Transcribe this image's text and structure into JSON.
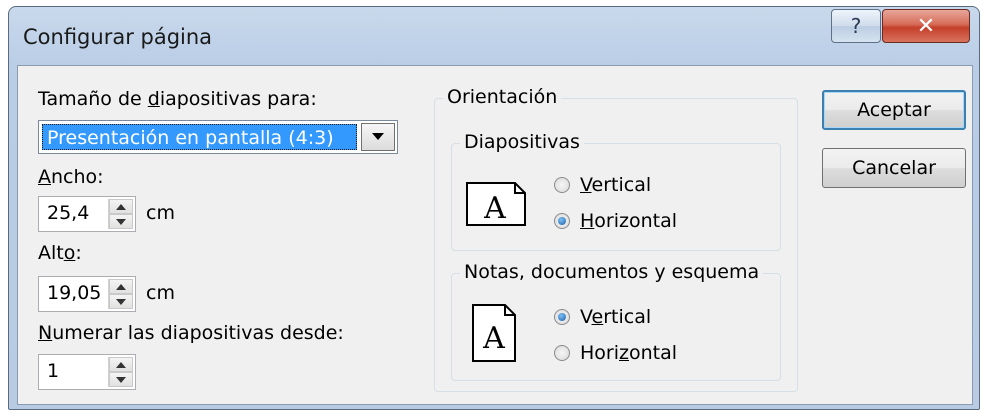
{
  "window": {
    "title": "Configurar página"
  },
  "size_for": {
    "label_pre": "Tamaño de ",
    "label_key": "d",
    "label_post": "iapositivas para:",
    "selected": "Presentación en pantalla (4:3)"
  },
  "width": {
    "label_key": "A",
    "label_post": "ncho:",
    "value": "25,4",
    "unit": "cm"
  },
  "height": {
    "label_pre": "Alt",
    "label_key": "o",
    "label_post": ":",
    "value": "19,05",
    "unit": "cm"
  },
  "numbering": {
    "label_key": "N",
    "label_post": "umerar las diapositivas desde:",
    "value": "1"
  },
  "orientation": {
    "title": "Orientación",
    "slides": {
      "title": "Diapositivas",
      "icon_letter": "A",
      "vertical": {
        "pre": "",
        "key": "V",
        "post": "ertical",
        "selected": false
      },
      "horizontal": {
        "pre": "",
        "key": "H",
        "post": "orizontal",
        "selected": true
      }
    },
    "notes": {
      "title": "Notas, documentos y esquema",
      "icon_letter": "A",
      "vertical": {
        "pre": "V",
        "key": "e",
        "post": "rtical",
        "selected": true
      },
      "horizontal": {
        "pre": "Hori",
        "key": "z",
        "post": "ontal",
        "selected": false
      }
    }
  },
  "buttons": {
    "ok": "Aceptar",
    "cancel": "Cancelar"
  },
  "titlebar": {
    "help_glyph": "?",
    "close_glyph": "✕"
  },
  "colors": {
    "selection": "#3399ff",
    "default_button_border": "#3c7fb1",
    "close_red": "#c4402a"
  }
}
